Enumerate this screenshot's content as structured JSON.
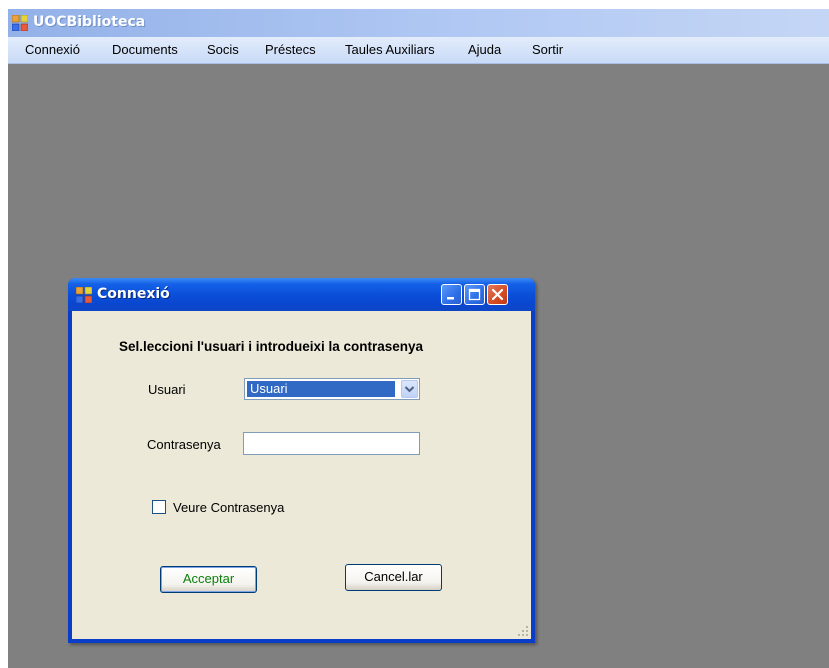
{
  "main_window": {
    "title": "UOCBiblioteca",
    "menu": [
      "Connexió",
      "Documents",
      "Socis",
      "Préstecs",
      "Taules Auxiliars",
      "Ajuda",
      "Sortir"
    ]
  },
  "dialog": {
    "title": "Connexió",
    "instruction": "Sel.leccioni l'usuari i introdueixi la contrasenya",
    "user_label": "Usuari",
    "user_value": "Usuari",
    "password_label": "Contrasenya",
    "password_value": "",
    "show_password_label": "Veure Contrasenya",
    "show_password_checked": false,
    "accept_label": "Acceptar",
    "cancel_label": "Cancel.lar"
  },
  "colors": {
    "desktop_bg": "#808080",
    "dialog_frame": "#0a46cf",
    "dialog_client": "#ece9d8",
    "selection": "#316ac5",
    "close_button": "#d44a23",
    "accept_text": "#0a7f0a"
  },
  "icons": {
    "app": "app-window-icon",
    "minimize": "minimize-icon",
    "maximize": "maximize-icon",
    "close": "close-icon",
    "dropdown": "chevron-down-icon",
    "grip": "resize-grip-icon"
  }
}
